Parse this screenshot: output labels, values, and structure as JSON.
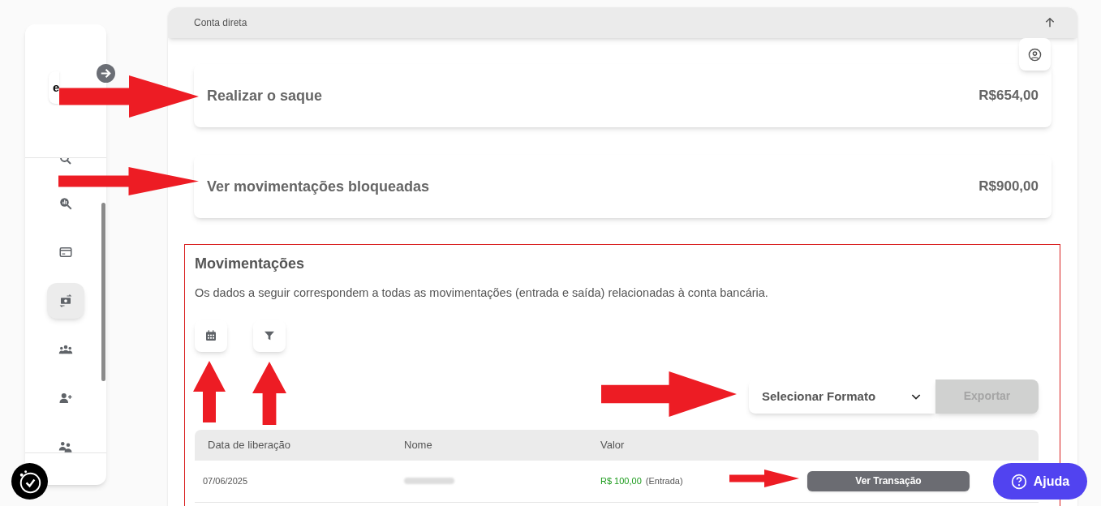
{
  "sidebar": {
    "logo": "e",
    "items": [
      {
        "kind": "search",
        "selected": false
      },
      {
        "kind": "chart",
        "selected": false
      },
      {
        "kind": "card",
        "selected": false
      },
      {
        "kind": "money",
        "selected": true
      },
      {
        "kind": "group",
        "selected": false
      },
      {
        "kind": "useradd",
        "selected": false
      },
      {
        "kind": "team",
        "selected": false
      }
    ]
  },
  "header": {
    "title": "Conta direta"
  },
  "cards": [
    {
      "label": "Realizar o saque",
      "amount": "R$654,00"
    },
    {
      "label": "Ver movimentações bloqueadas",
      "amount": "R$900,00"
    }
  ],
  "section": {
    "title": "Movimentações",
    "description": "Os dados a seguir correspondem a todas as movimentações (entrada e saída) relacionadas à conta bancária.",
    "format_select": {
      "placeholder": "Selecionar Formato"
    },
    "export_button": {
      "label": "Exportar",
      "disabled": true
    }
  },
  "table": {
    "columns": [
      "Data de liberação",
      "Nome",
      "Valor"
    ],
    "rows": [
      {
        "date": "07/06/2025",
        "amount": "R$ 100,00",
        "type": "(Entrada)",
        "action": "Ver Transação"
      }
    ]
  },
  "help_button": {
    "label": "Ajuda"
  }
}
